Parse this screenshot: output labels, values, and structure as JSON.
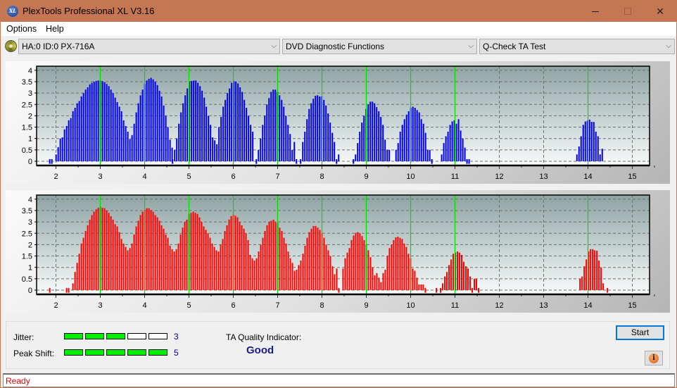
{
  "window": {
    "title": "PlexTools Professional XL V3.16",
    "app_icon": "XL",
    "controls": [
      "minimize-icon",
      "maximize-icon",
      "close-icon"
    ]
  },
  "menu": [
    "Options",
    "Help"
  ],
  "toolbar": {
    "drive": "HA:0 ID:0  PX-716A",
    "function": "DVD Diagnostic Functions",
    "test": "Q-Check TA Test"
  },
  "colors": {
    "titlebar": "#c47752",
    "chart1_bars": "#0000ee",
    "chart2_bars": "#ff0000",
    "marker_lines": "#00dd00",
    "meter_on": "#00ee00",
    "status_text": "#e00000",
    "quality_text": "#1a1a8c"
  },
  "chart_data": [
    {
      "type": "bar",
      "name": "TA distribution (upper)",
      "x_ticks": [
        2,
        3,
        4,
        5,
        6,
        7,
        8,
        9,
        10,
        11,
        12,
        13,
        14,
        15
      ],
      "y_ticks": [
        "0",
        "0.5",
        "1",
        "1.5",
        "2",
        "2.5",
        "3",
        "3.5",
        "4"
      ],
      "xlim": [
        1.6,
        15.4
      ],
      "ylim": [
        -0.1,
        4.2
      ],
      "grid": true,
      "marker_lines_x": [
        3,
        4,
        5,
        6,
        7,
        8,
        9,
        10,
        11,
        14
      ],
      "bar_color": "#0000ee",
      "step": 0.0476,
      "clusters": [
        {
          "start": 1.86,
          "values": [
            0.02,
            0.02,
            0,
            0.3,
            0.62,
            1.0,
            1.05,
            1.4,
            1.55,
            1.8,
            1.9,
            2.2,
            2.35,
            2.55,
            2.65,
            2.85,
            3.0,
            3.15,
            3.25,
            3.38,
            3.45,
            3.5,
            3.53,
            3.55,
            3.55,
            3.52,
            3.48,
            3.4,
            3.3,
            3.15,
            3.0,
            2.8,
            2.6,
            2.4,
            2.2,
            1.8,
            1.55,
            1.3,
            0.98,
            1.15,
            1.65,
            2.15,
            2.55,
            2.9,
            3.15,
            3.4,
            3.55,
            3.62,
            3.67,
            3.6,
            3.5,
            3.35,
            3.1,
            2.85,
            2.45,
            2.0,
            1.5,
            0.95,
            0.6
          ]
        },
        {
          "start": 4.63,
          "values": [
            0.02,
            0.5,
            1.0,
            1.65,
            2.15,
            2.55,
            2.9,
            3.2,
            3.5,
            3.53,
            3.55,
            3.55,
            3.45,
            3.3,
            3.1,
            2.8,
            2.4,
            2.0,
            1.6,
            1.05,
            0.92,
            0.75,
            1.5,
            1.95,
            2.4,
            2.7,
            3.0,
            3.2,
            3.45,
            3.52,
            3.5,
            3.42,
            3.25,
            3.05,
            2.7,
            2.35,
            2.0,
            1.6,
            1.3
          ]
        },
        {
          "start": 6.52,
          "values": [
            0.02,
            0.5,
            1.0,
            1.6,
            2.0,
            2.5,
            2.78,
            3.05,
            3.15,
            3.15,
            3.05,
            2.9,
            2.7,
            2.4,
            2.0,
            1.6,
            1.2,
            0.5,
            0.85,
            0.02,
            0,
            0.02,
            0.85,
            1.3,
            1.85,
            2.3,
            2.55,
            2.75,
            2.88,
            2.9,
            2.85,
            2.85,
            2.7,
            2.45,
            2.1,
            1.7,
            1.25,
            0.85,
            0.02,
            0.3
          ]
        },
        {
          "start": 8.71,
          "values": [
            0.02,
            0.3,
            0.8,
            1.3,
            1.7,
            2.0,
            2.3,
            2.5,
            2.62,
            2.62,
            2.55,
            2.38,
            2.2,
            1.95,
            1.6,
            0.95,
            0.5,
            0.5
          ]
        },
        {
          "start": 9.67,
          "values": [
            0.5,
            0.8,
            1.3,
            1.6,
            1.85,
            2.05,
            2.2,
            2.35,
            2.4,
            2.35,
            2.25,
            2.15,
            1.85,
            1.65,
            1.25,
            0.5,
            0.5,
            0.02
          ]
        },
        {
          "start": 10.7,
          "values": [
            0.3,
            0.8,
            1.1,
            1.3,
            1.6,
            1.75,
            1.8,
            1.65,
            1.85,
            1.35,
            1.0,
            0.6,
            0.02,
            0.02
          ]
        },
        {
          "start": 13.75,
          "values": [
            0.3,
            0.65,
            1.1,
            1.6,
            1.75,
            1.78,
            1.83,
            1.73,
            1.73,
            1.3,
            1.1,
            0.3,
            0.55
          ]
        }
      ]
    },
    {
      "type": "bar",
      "name": "TA distribution (lower)",
      "x_ticks": [
        2,
        3,
        4,
        5,
        6,
        7,
        8,
        9,
        10,
        11,
        12,
        13,
        14,
        15
      ],
      "y_ticks": [
        "0",
        "0.5",
        "1",
        "1.5",
        "2",
        "2.5",
        "3",
        "3.5",
        "4"
      ],
      "xlim": [
        1.6,
        15.4
      ],
      "ylim": [
        -0.1,
        4.2
      ],
      "grid": true,
      "marker_lines_x": [
        3,
        4,
        5,
        6,
        7,
        8,
        9,
        10,
        11,
        14
      ],
      "bar_color": "#ff0000",
      "step": 0.0476,
      "clusters": [
        {
          "start": 1.86,
          "values": [
            0.02
          ]
        },
        {
          "start": 2.24,
          "values": [
            0.02,
            0.02,
            0,
            0.3,
            0.8,
            1.2,
            1.6,
            2.05,
            2.3,
            2.6,
            2.85,
            3.1,
            3.3,
            3.45,
            3.55,
            3.62,
            3.67,
            3.62,
            3.6,
            3.5,
            3.4,
            3.25,
            3.1,
            2.9,
            2.8,
            2.55,
            2.25,
            2.05,
            1.9,
            1.75,
            1.85,
            2.05,
            2.45,
            2.8,
            3.05,
            3.3,
            3.45,
            3.52,
            3.6,
            3.6,
            3.52,
            3.45,
            3.3,
            3.2,
            3.05,
            2.85,
            2.7,
            2.45,
            2.3,
            1.95,
            1.8,
            1.7,
            1.8,
            2.05,
            2.45,
            2.75,
            3.0,
            3.1,
            3.35,
            3.4,
            3.45,
            3.4,
            3.35,
            3.2,
            3.0,
            2.8,
            2.65,
            2.5,
            2.3,
            2.05,
            1.9,
            1.75,
            1.7,
            2.0,
            2.25,
            2.6,
            2.85,
            3.1,
            3.25,
            3.32,
            3.27,
            3.2,
            3.0,
            2.85,
            2.7,
            2.5,
            2.2,
            1.55,
            1.4,
            1.3,
            1.4,
            1.7,
            2.0,
            2.3,
            2.6,
            2.85,
            3.0,
            3.05,
            3.1,
            3.0,
            2.95,
            2.75,
            2.6,
            2.3,
            2.05,
            1.7,
            1.4,
            1.2,
            0.85,
            0.9,
            1.1,
            1.3,
            1.6,
            1.95,
            2.3,
            2.55,
            2.7,
            2.82,
            2.82,
            2.75,
            2.65,
            2.5,
            2.3,
            2.0,
            1.75,
            1.5,
            1.05,
            0.7,
            0.95,
            0.02,
            0,
            0.95,
            1.4,
            1.65,
            1.85,
            2.2,
            2.4,
            2.52,
            2.55,
            2.5,
            2.38,
            2.2,
            2.0,
            1.75,
            1.45,
            1.0,
            0.65,
            0.75,
            0.55,
            0.35,
            0.75,
            0.9,
            1.5,
            1.85,
            2.0,
            2.2,
            2.32,
            2.35,
            2.3,
            2.25,
            2.05,
            1.9,
            1.6,
            1.4,
            0.95,
            0.85,
            0.55,
            0.25,
            0.25,
            0.25,
            0.02
          ]
        },
        {
          "start": 10.58,
          "values": [
            0.02,
            0,
            0.02,
            0.3,
            0.6,
            0.8,
            1.1,
            1.35,
            1.6,
            1.65,
            1.7,
            1.65,
            1.55,
            1.25,
            1.05,
            0.95,
            0.6,
            0.02,
            0.5,
            0.5,
            0.02
          ]
        },
        {
          "start": 13.82,
          "values": [
            0.5,
            0.6,
            1.05,
            1.35,
            1.7,
            1.8,
            1.8,
            1.75,
            1.73,
            1.3,
            1.0,
            0.3,
            0,
            0.02
          ]
        }
      ]
    }
  ],
  "results": {
    "jitter_label": "Jitter:",
    "jitter_value": "3",
    "jitter_level": 3,
    "peak_shift_label": "Peak Shift:",
    "peak_shift_value": "5",
    "peak_shift_level": 5,
    "meter_segments": 5,
    "ta_quality_label": "TA Quality Indicator:",
    "ta_quality_value": "Good"
  },
  "buttons": {
    "start": "Start",
    "info_icon": "i"
  },
  "status": "Ready"
}
